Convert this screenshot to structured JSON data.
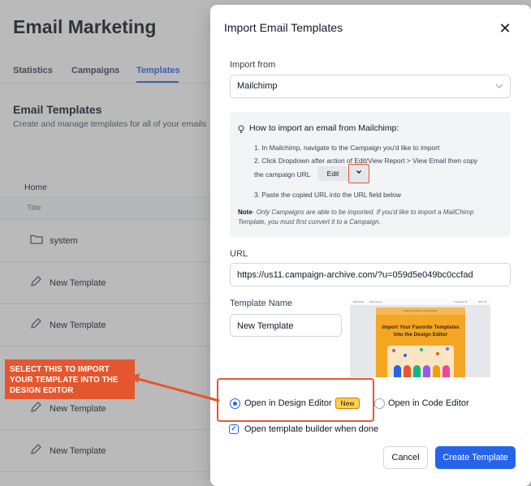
{
  "background": {
    "title": "Email Marketing",
    "tabs": [
      {
        "label": "Statistics"
      },
      {
        "label": "Campaigns"
      },
      {
        "label": "Templates"
      }
    ],
    "section_title": "Email Templates",
    "section_subtitle": "Create and manage templates for all of your emails",
    "breadcrumb": "Home",
    "column_title": "Title",
    "rows": [
      {
        "label": "system",
        "icon": "folder-icon"
      },
      {
        "label": "New Template",
        "icon": "pencil-icon"
      },
      {
        "label": "New Template",
        "icon": "pencil-icon"
      },
      {
        "label": "New Template",
        "icon": "pencil-icon"
      },
      {
        "label": "New Template",
        "icon": "pencil-icon"
      }
    ]
  },
  "modal": {
    "title": "Import Email Templates",
    "close_label": "✕",
    "import_from_label": "Import from",
    "import_from_value": "Mailchimp",
    "howto": {
      "heading": "How to import an email from Mailchimp:",
      "step1": "1. In Mailchimp, navigate to the Campaign you'd like to import",
      "step2a": "2. Click Dropdown after action of Edit/View Report > View Email then copy",
      "step2b": "the campaign URL",
      "edit_label": "Edit",
      "step3": "3. Paste the copied URL into the URL field below",
      "note_label": "Note",
      "note_text": "- Only Campaigns are able to be imported. If you'd like to import a MailChimp Template, you must first convert it to a Campaign."
    },
    "url_label": "URL",
    "url_value": "https://us11.campaign-archive.com/?u=059d5e049bc0ccfad",
    "template_name_label": "Template Name",
    "template_name_value": "New Template",
    "preview": {
      "top_left": "Subscribe",
      "top_mid": "Past Issues",
      "top_right": "Translate ▼",
      "top_rss": "RSS ▼",
      "banner": "View this email in your browser",
      "headline": "Import Your Favorite Templates into the Design Editor"
    },
    "options": {
      "design_editor_label": "Open in Design Editor",
      "new_badge": "New",
      "code_editor_label": "Open in Code Editor",
      "selected": "design"
    },
    "open_builder_label": "Open template builder when done",
    "cancel_label": "Cancel",
    "create_label": "Create Template"
  },
  "annotation": {
    "callout_text": "SELECT THIS TO IMPORT YOUR TEMPLATE INTO THE DESIGN EDITOR",
    "color": "#e4572e"
  },
  "colors": {
    "accent": "#2563eb",
    "annotation": "#e4572e",
    "badge": "#fcd34d"
  }
}
